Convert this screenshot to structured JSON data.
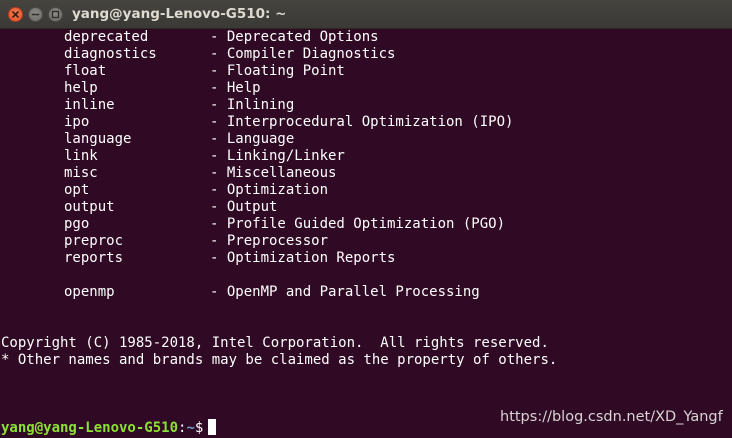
{
  "window": {
    "title": "yang@yang-Lenovo-G510: ~"
  },
  "options": [
    {
      "name": "deprecated",
      "desc": "- Deprecated Options"
    },
    {
      "name": "diagnostics",
      "desc": "- Compiler Diagnostics"
    },
    {
      "name": "float",
      "desc": "- Floating Point"
    },
    {
      "name": "help",
      "desc": "- Help"
    },
    {
      "name": "inline",
      "desc": "- Inlining"
    },
    {
      "name": "ipo",
      "desc": "- Interprocedural Optimization (IPO)"
    },
    {
      "name": "language",
      "desc": "- Language"
    },
    {
      "name": "link",
      "desc": "- Linking/Linker"
    },
    {
      "name": "misc",
      "desc": "- Miscellaneous"
    },
    {
      "name": "opt",
      "desc": "- Optimization"
    },
    {
      "name": "output",
      "desc": "- Output"
    },
    {
      "name": "pgo",
      "desc": "- Profile Guided Optimization (PGO)"
    },
    {
      "name": "preproc",
      "desc": "- Preprocessor"
    },
    {
      "name": "reports",
      "desc": "- Optimization Reports"
    }
  ],
  "openmp": {
    "name": "openmp",
    "desc": "- OpenMP and Parallel Processing"
  },
  "copyright": "Copyright (C) 1985-2018, Intel Corporation.  All rights reserved.",
  "trademark": "* Other names and brands may be claimed as the property of others.",
  "prompt": {
    "user_host": "yang@yang-Lenovo-G510",
    "colon": ":",
    "path": "~",
    "symbol": "$"
  },
  "watermark": "https://blog.csdn.net/XD_Yangf",
  "colors": {
    "background": "#300a24",
    "prompt_user": "#8ae234",
    "prompt_path": "#729fcf",
    "close_button": "#e95420"
  }
}
